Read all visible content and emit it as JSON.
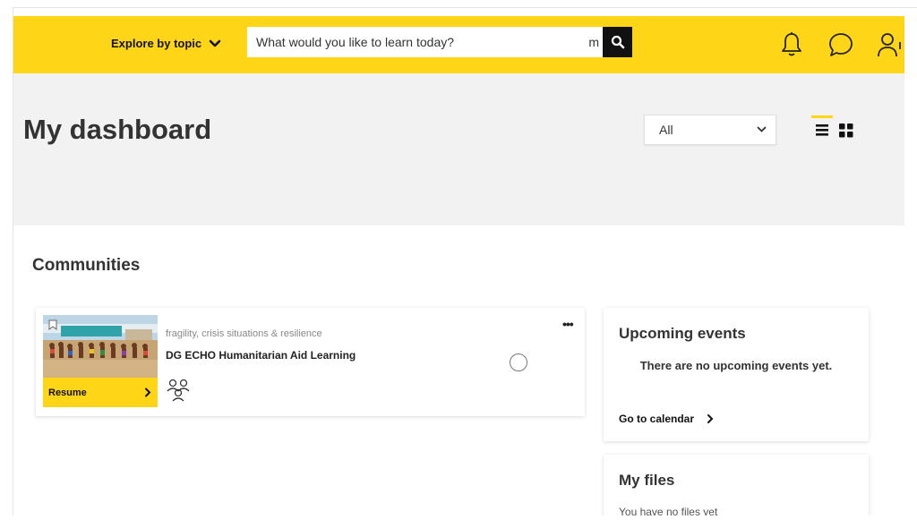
{
  "header": {
    "explore_label": "Explore by topic",
    "search_placeholder": "What would you like to learn today?",
    "search_suffix": "m"
  },
  "dashboard": {
    "title": "My dashboard",
    "filter_value": "All"
  },
  "communities": {
    "section_title": "Communities",
    "items": [
      {
        "category": "fragility, crisis situations & resilience",
        "title": "DG ECHO Humanitarian Aid Learning",
        "resume_label": "Resume",
        "more_label": "•••"
      }
    ]
  },
  "upcoming_events": {
    "title": "Upcoming events",
    "empty_text": "There are no upcoming events yet.",
    "link_label": "Go to calendar"
  },
  "my_files": {
    "title": "My files",
    "empty_text": "You have no files yet"
  },
  "colors": {
    "accent": "#ffd617",
    "header_bg": "#ffd617",
    "dashboard_bg": "#f2f2f2",
    "dark": "#111111"
  },
  "icons": [
    "chevron-down-icon",
    "search-icon",
    "bell-icon",
    "chat-icon",
    "user-icon",
    "list-view-icon",
    "grid-view-icon",
    "bookmark-icon",
    "chevron-right-icon",
    "people-icon",
    "more-icon"
  ]
}
